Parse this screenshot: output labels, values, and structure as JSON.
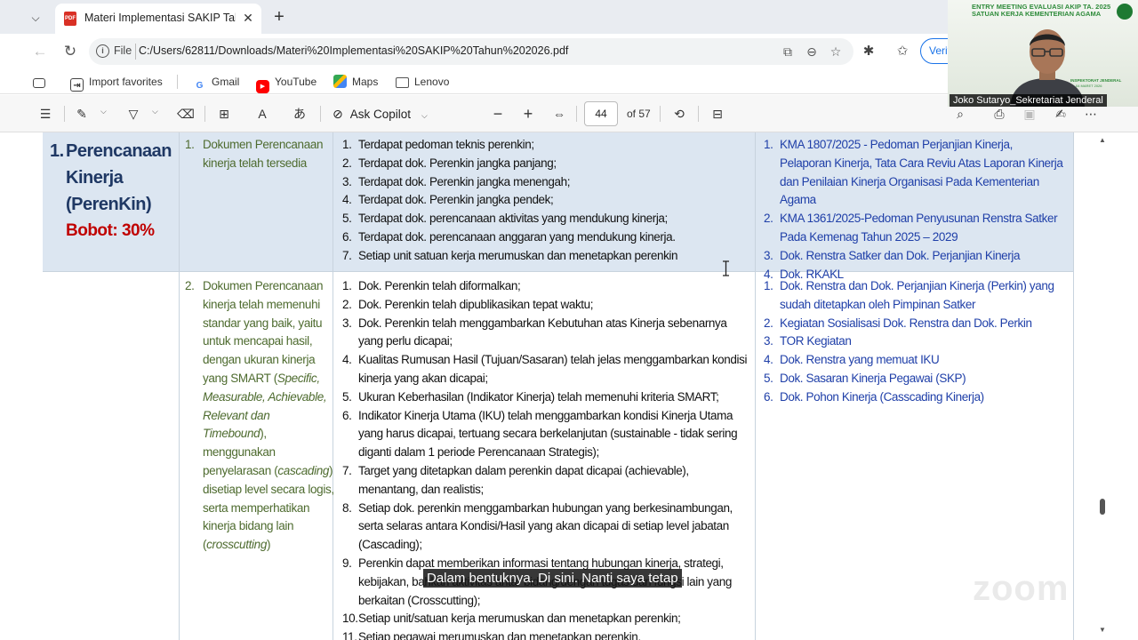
{
  "browser": {
    "tab_title": "Materi Implementasi SAKIP Tahun 2026.pdf",
    "tab_icon_text": "PDF",
    "address_scheme": "File",
    "url": "C:/Users/62811/Downloads/Materi%20Implementasi%20SAKIP%20Tahun%202026.pdf",
    "verify_label": "Verif",
    "favorites": [
      {
        "label": "Import favorites",
        "icon": "import-icon"
      },
      {
        "label": "Gmail",
        "icon": "google-icon"
      },
      {
        "label": "YouTube",
        "icon": "youtube-icon"
      },
      {
        "label": "Maps",
        "icon": "maps-icon"
      },
      {
        "label": "Lenovo",
        "icon": "folder-icon"
      }
    ]
  },
  "pdf_toolbar": {
    "copilot_label": "Ask Copilot",
    "page_current": "44",
    "page_total_label": "of 57"
  },
  "document": {
    "aspect": {
      "number": "1.",
      "lines": [
        "Perencanaan",
        "Kinerja",
        "(PerenKin)"
      ],
      "weight": "Bobot: 30%"
    },
    "rows": [
      {
        "criterion_number": "1.",
        "criterion": "Dokumen Perencanaan kinerja telah tersedia",
        "evidence": [
          "Terdapat pedoman teknis perenkin;",
          "Terdapat dok. Perenkin jangka panjang;",
          "Terdapat dok. Perenkin jangka menengah;",
          "Terdapat dok. Perenkin jangka pendek;",
          "Terdapat dok. perencanaan aktivitas yang mendukung kinerja;",
          "Terdapat dok. perencanaan anggaran yang mendukung kinerja.",
          "Setiap unit satuan kerja merumuskan dan menetapkan perenkin"
        ],
        "references": [
          "KMA 1807/2025 - Pedoman Perjanjian Kinerja, Pelaporan Kinerja, Tata Cara Reviu Atas Laporan Kinerja dan Penilaian Kinerja Organisasi Pada Kementerian Agama",
          "KMA 1361/2025-Pedoman Penyusunan Renstra Satker Pada Kemenag Tahun 2025 – 2029",
          "Dok. Renstra Satker dan Dok. Perjanjian Kinerja",
          "Dok. RKAKL"
        ]
      },
      {
        "criterion_number": "2.",
        "criterion_parts": [
          "Dokumen Perencanaan kinerja telah memenuhi standar yang baik, yaitu untuk mencapai hasil, dengan ukuran kinerja yang SMART (",
          "Specific, Measurable, Achievable, Relevant dan Timebound",
          "), menggunakan penyelarasan (",
          "cascading",
          ") disetiap level secara logis, serta memperhatikan kinerja bidang lain (",
          "crosscutting",
          ")"
        ],
        "evidence": [
          "Dok. Perenkin telah diformalkan;",
          "Dok. Perenkin telah dipublikasikan tepat waktu;",
          "Dok. Perenkin telah menggambarkan Kebutuhan atas Kinerja sebenarnya yang perlu dicapai;",
          "Kualitas Rumusan Hasil (Tujuan/Sasaran) telah jelas menggambarkan kondisi kinerja yang akan dicapai;",
          "Ukuran Keberhasilan (Indikator Kinerja) telah memenuhi kriteria SMART;",
          "Indikator Kinerja Utama (IKU) telah menggambarkan kondisi Kinerja Utama yang harus dicapai, tertuang secara berkelanjutan (sustainable - tidak sering diganti dalam 1 periode Perencanaan Strategis);",
          "Target yang ditetapkan dalam perenkin dapat dicapai (achievable), menantang, dan realistis;",
          "Setiap dok. perenkin menggambarkan hubungan yang berkesinambungan, serta selaras antara Kondisi/Hasil yang akan dicapai di setiap level jabatan (Cascading);",
          "Perenkin dapat memberikan informasi tentang hubungan kinerja, strategi, kebijakan, bahkan aktivitas antar bidang/dengan tugas dan fungsi lain yang berkaitan (Crosscutting);",
          "Setiap unit/satuan kerja merumuskan dan menetapkan perenkin;",
          "Setiap pegawai merumuskan dan menetapkan perenkin."
        ],
        "references": [
          "Dok. Renstra dan Dok. Perjanjian Kinerja (Perkin) yang sudah ditetapkan oleh Pimpinan Satker",
          "Kegiatan Sosialisasi Dok. Renstra dan Dok. Perkin",
          "TOR Kegiatan",
          "Dok. Renstra yang memuat IKU",
          "Dok. Sasaran Kinerja Pegawai (SKP)",
          "Dok. Pohon Kinerja (Casscading Kinerja)"
        ]
      }
    ]
  },
  "zoom": {
    "banner_line1": "ENTRY MEETING EVALUASI AKIP TA. 2025",
    "banner_line2": "SATUAN KERJA KEMENTERIAN AGAMA",
    "inspektorat_line1": "INSPEKTORAT JENDERAL",
    "inspektorat_line2": "04 MARET 2026",
    "participant_name": "Joko Sutaryo_Sekretariat Jenderal",
    "caption": "Dalam bentuknya. Di sini. Nanti saya tetap",
    "watermark": "zoom"
  },
  "colors": {
    "row_highlight": "#dce6f1",
    "aspect_title": "#1f3864",
    "weight_red": "#c00000",
    "criterion_green": "#4e6b2f",
    "reference_blue": "#1f3fa8",
    "accent": "#1a73e8"
  }
}
